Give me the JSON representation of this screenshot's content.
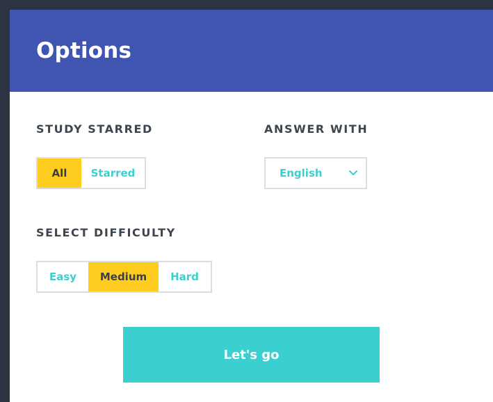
{
  "colors": {
    "header_bg": "#4054b2",
    "accent_teal": "#3ccfcf",
    "selected_yellow": "#ffcd1f",
    "label_text": "#3d4550"
  },
  "header": {
    "title": "Options"
  },
  "study_starred": {
    "label": "STUDY STARRED",
    "options": [
      "All",
      "Starred"
    ],
    "selected": "All"
  },
  "answer_with": {
    "label": "ANSWER WITH",
    "value": "English",
    "icon": "chevron-down-icon"
  },
  "difficulty": {
    "label": "SELECT DIFFICULTY",
    "options": [
      "Easy",
      "Medium",
      "Hard"
    ],
    "selected": "Medium"
  },
  "start_button": {
    "label": "Let's go"
  }
}
